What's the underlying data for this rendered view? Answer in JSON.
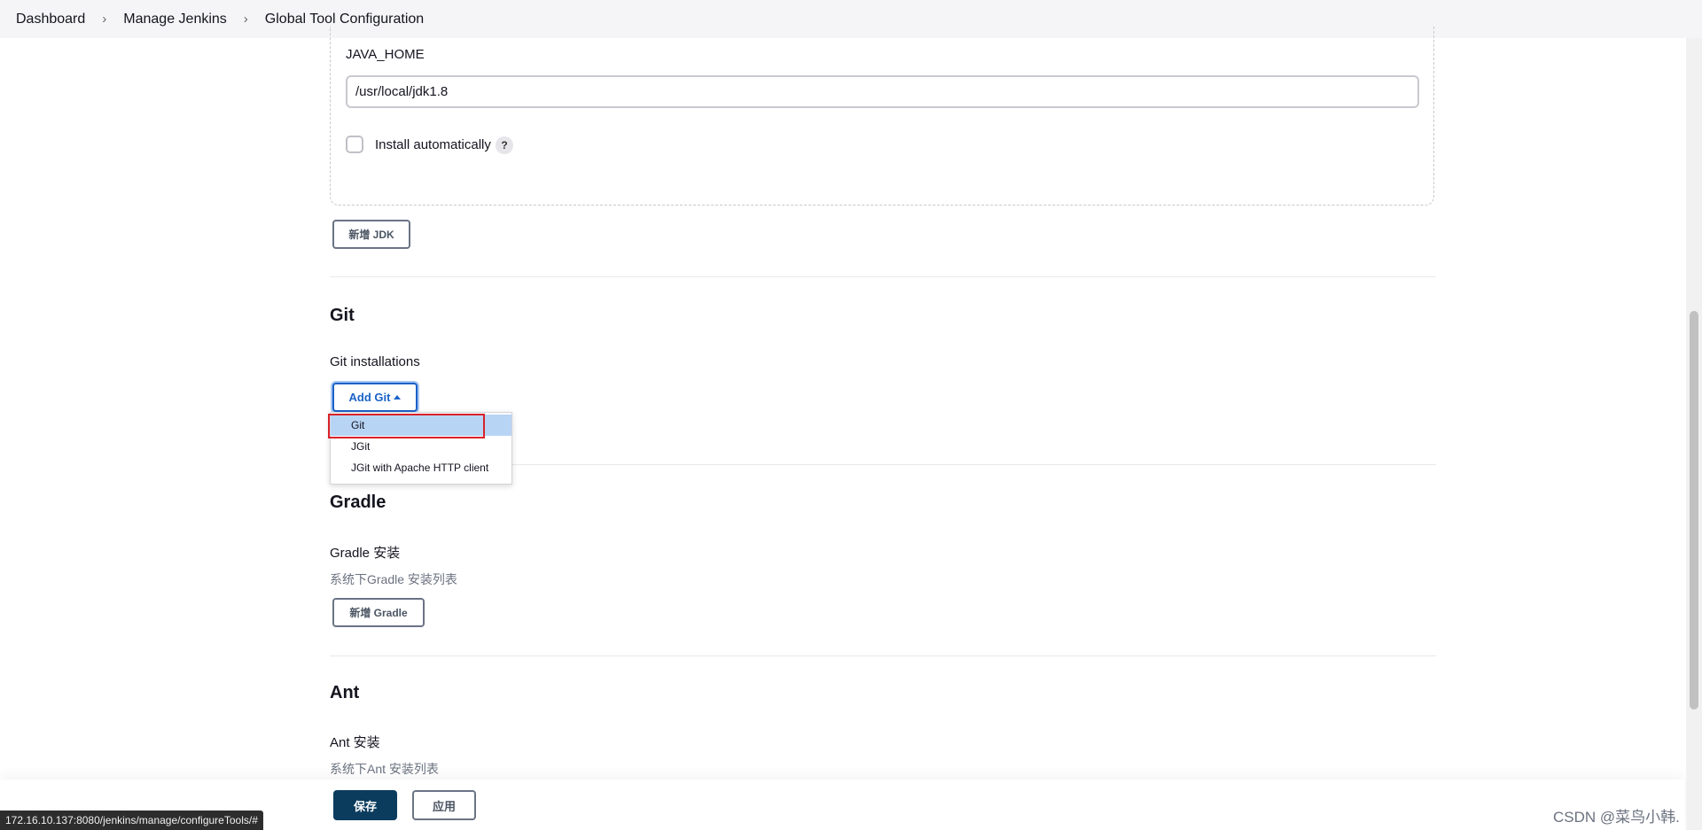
{
  "breadcrumb": [
    "Dashboard",
    "Manage Jenkins",
    "Global Tool Configuration"
  ],
  "jdk": {
    "java_home_label": "JAVA_HOME",
    "java_home_value": "/usr/local/jdk1.8",
    "install_auto_label": "Install automatically",
    "help_glyph": "?",
    "add_button": "新增 JDK"
  },
  "git": {
    "title": "Git",
    "installations_label": "Git installations",
    "add_button": "Add Git",
    "menu": [
      "Git",
      "JGit",
      "JGit with Apache HTTP client"
    ]
  },
  "gradle": {
    "title": "Gradle",
    "installations_label": "Gradle 安装",
    "description": "系统下Gradle 安装列表",
    "add_button": "新增 Gradle"
  },
  "ant": {
    "title": "Ant",
    "installations_label": "Ant 安装",
    "description": "系统下Ant 安装列表"
  },
  "footer": {
    "save_button": "保存",
    "apply_button": "应用"
  },
  "status_url": "172.16.10.137:8080/jenkins/manage/configureTools/#",
  "watermark": "CSDN @菜鸟小韩."
}
